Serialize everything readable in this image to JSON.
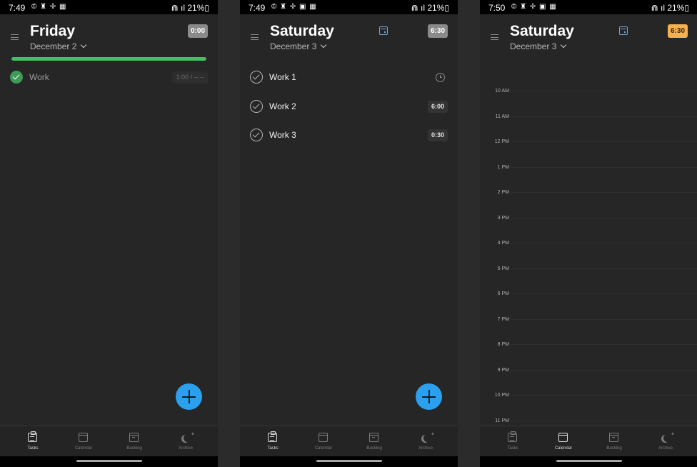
{
  "statusbars": [
    {
      "time": "7:49",
      "icons": "© ♜ ✢ ▦",
      "right": "⋒ ıl 21%▯"
    },
    {
      "time": "7:49",
      "icons": "© ♜ ✢ ▣ ▦",
      "right": "⋒ ıl 21%▯"
    },
    {
      "time": "7:50",
      "icons": "© ♜ ✢ ▣ ▦",
      "right": "⋒ ıl 21%▯"
    }
  ],
  "screen1": {
    "title": "Friday",
    "date": "December 2",
    "timer": "0:00",
    "progress": 1.0,
    "tasks": [
      {
        "name": "Work",
        "duration": "1:00 / --:--",
        "done": true
      }
    ]
  },
  "screen2": {
    "title": "Saturday",
    "date": "December 3",
    "timer": "6:30",
    "tasks": [
      {
        "name": "Work 1",
        "duration": "",
        "icon": "clock-icon"
      },
      {
        "name": "Work 2",
        "duration": "6:00"
      },
      {
        "name": "Work 3",
        "duration": "0:30"
      }
    ]
  },
  "screen3": {
    "title": "Saturday",
    "date": "December 3",
    "timer": "6:30",
    "timer_color": "#f6b04f",
    "hours": [
      "10 AM",
      "11 AM",
      "12 PM",
      "1 PM",
      "2 PM",
      "3 PM",
      "4 PM",
      "5 PM",
      "6 PM",
      "7 PM",
      "8 PM",
      "9 PM",
      "10 PM",
      "11 PM"
    ]
  },
  "nav": {
    "items": [
      {
        "label": "Tasks",
        "icon": "tasks-icon"
      },
      {
        "label": "Calendar",
        "icon": "calendar-icon"
      },
      {
        "label": "Backlog",
        "icon": "backlog-icon"
      },
      {
        "label": "Archive",
        "icon": "archive-icon"
      }
    ]
  },
  "colors": {
    "accent_green": "#43c065",
    "fab_blue": "#2aa0ee",
    "background": "#262626"
  }
}
